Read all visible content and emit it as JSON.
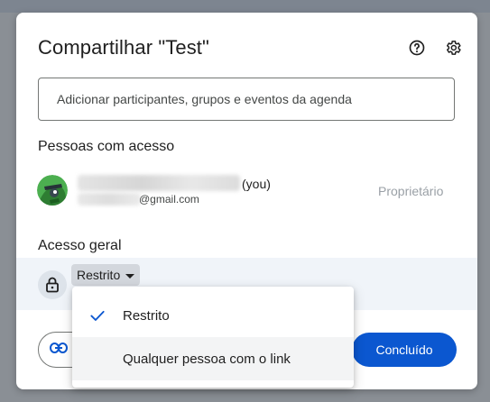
{
  "dialog": {
    "title": "Compartilhar \"Test\"",
    "help_icon": "help-circle-icon",
    "settings_icon": "gear-icon"
  },
  "add_people": {
    "placeholder": "Adicionar participantes, grupos e eventos da agenda",
    "value": ""
  },
  "people_section": {
    "title": "Pessoas com acesso",
    "people": [
      {
        "you_label": "(you)",
        "email_suffix": "@gmail.com",
        "role": "Proprietário"
      }
    ]
  },
  "general_access": {
    "title": "Acesso geral",
    "selected": "Restrito",
    "lock_icon": "lock-icon"
  },
  "dropdown_menu": {
    "items": [
      {
        "label": "Restrito",
        "checked": true
      },
      {
        "label": "Qualquer pessoa com o link",
        "checked": false
      }
    ]
  },
  "footer": {
    "copy_link_icon": "link-icon",
    "done_label": "Concluído"
  },
  "colors": {
    "primary": "#0b57d0",
    "access_row_bg": "#f0f4f9",
    "muted_text": "#9aa0a6"
  }
}
